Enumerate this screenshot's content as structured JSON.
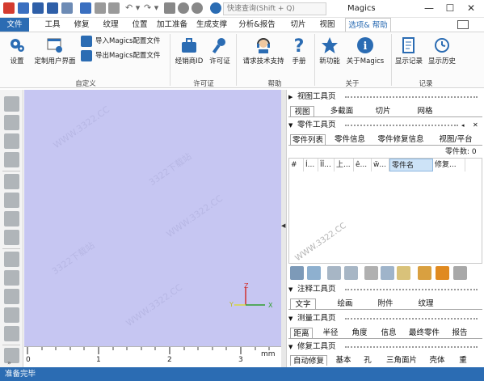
{
  "window": {
    "title": "Magics",
    "search_placeholder": "快速查询(Shift + Q)",
    "minimize": "—",
    "maximize": "☐",
    "close": "✕"
  },
  "tabs": [
    {
      "label": "文件"
    },
    {
      "label": "工具"
    },
    {
      "label": "修复"
    },
    {
      "label": "纹理"
    },
    {
      "label": "位置"
    },
    {
      "label": "加工准备"
    },
    {
      "label": "生成支撑"
    },
    {
      "label": "分析&报告"
    },
    {
      "label": "切片"
    },
    {
      "label": "视图"
    },
    {
      "label": "选项& 帮助"
    }
  ],
  "ribbon": {
    "customize": {
      "settings": "设置",
      "custom_ui": "定制用户界面",
      "import_cfg": "导入Magics配置文件",
      "export_cfg": "导出Magics配置文件",
      "label": "自定义"
    },
    "license": {
      "dealer_id": "经销商ID",
      "license": "许可证",
      "label": "许可证"
    },
    "help": {
      "support": "请求技术支持",
      "manual": "手册",
      "label": "帮助"
    },
    "about": {
      "new_features": "新功能",
      "about_magics": "关于Magics",
      "label": "关于"
    },
    "log": {
      "show_log": "显示记录",
      "show_history": "显示历史",
      "label": "记录"
    }
  },
  "viewport": {
    "ruler_labels": [
      "0",
      "1",
      "2",
      "3"
    ],
    "ruler_unit": "mm",
    "axis_z": "Z",
    "axis_y": "Y",
    "axis_x": "X",
    "watermarks": [
      "WWW.3322.CC",
      "3322下载站",
      "WWW.3322.CC",
      "3322下载站",
      "WWW.3322.CC"
    ]
  },
  "panel": {
    "view_toolbar": {
      "title": "视图工具页",
      "tabs": [
        "视图",
        "多截面",
        "切片",
        "网格"
      ]
    },
    "part_toolbar": {
      "title": "零件工具页",
      "tabs": [
        "零件列表",
        "零件信息",
        "零件修复信息",
        "视图/平台"
      ],
      "part_count_label": "零件数:",
      "part_count": "0",
      "columns": [
        "#",
        "Í...",
        "ÎÎ...",
        "上...",
        "ê...",
        "ẅ...",
        "零件名",
        "修复..."
      ]
    },
    "annotation_toolbar": {
      "title": "注释工具页",
      "tabs": [
        "文字",
        "绘画",
        "附件",
        "纹理"
      ]
    },
    "measure_toolbar": {
      "title": "测量工具页",
      "tabs": [
        "距离",
        "半径",
        "角度",
        "信息",
        "最终零件",
        "报告"
      ]
    },
    "repair_toolbar": {
      "title": "修复工具页",
      "tabs": [
        "自动修复",
        "基本",
        "孔",
        "三角面片",
        "壳体",
        "重"
      ]
    }
  },
  "status": {
    "text": "准备完毕"
  },
  "colors": {
    "accent": "#2b6cb3",
    "viewport_bg": "#c6c6f2",
    "axis_x": "#2e9e2e",
    "axis_y": "#d8d840",
    "axis_z": "#d03030"
  }
}
